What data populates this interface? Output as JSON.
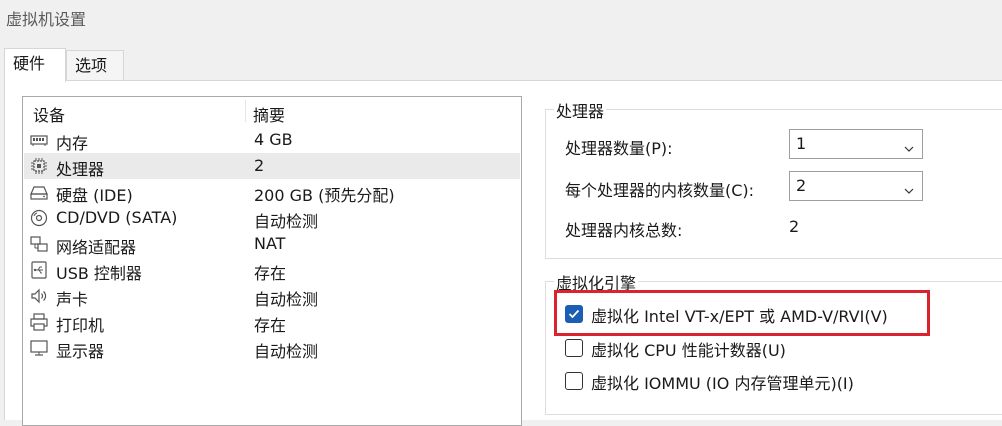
{
  "window": {
    "title": "虚拟机设置"
  },
  "tabs": [
    {
      "label": "硬件",
      "active": true
    },
    {
      "label": "选项",
      "active": false
    }
  ],
  "device_list": {
    "headers": {
      "device": "设备",
      "summary": "摘要"
    },
    "rows": [
      {
        "icon": "memory-icon",
        "name": "内存",
        "summary": "4 GB"
      },
      {
        "icon": "processor-icon",
        "name": "处理器",
        "summary": "2",
        "selected": true
      },
      {
        "icon": "harddisk-icon",
        "name": "硬盘 (IDE)",
        "summary": "200 GB (预先分配)"
      },
      {
        "icon": "cd-dvd-icon",
        "name": "CD/DVD (SATA)",
        "summary": "自动检测"
      },
      {
        "icon": "network-adapter-icon",
        "name": "网络适配器",
        "summary": "NAT"
      },
      {
        "icon": "usb-icon",
        "name": "USB 控制器",
        "summary": "存在"
      },
      {
        "icon": "sound-card-icon",
        "name": "声卡",
        "summary": "自动检测"
      },
      {
        "icon": "printer-icon",
        "name": "打印机",
        "summary": "存在"
      },
      {
        "icon": "display-icon",
        "name": "显示器",
        "summary": "自动检测"
      }
    ]
  },
  "processors": {
    "group_title": "处理器",
    "count_label": "处理器数量(P):",
    "count_value": "1",
    "cores_label": "每个处理器的内核数量(C):",
    "cores_value": "2",
    "total_label": "处理器内核总数:",
    "total_value": "2"
  },
  "virtualization": {
    "group_title": "虚拟化引擎",
    "options": [
      {
        "label": "虚拟化 Intel VT-x/EPT 或 AMD-V/RVI(V)",
        "checked": true
      },
      {
        "label": "虚拟化 CPU 性能计数器(U)",
        "checked": false
      },
      {
        "label": "虚拟化 IOMMU (IO 内存管理单元)(I)",
        "checked": false
      }
    ]
  },
  "colors": {
    "accent": "#1a5fb4",
    "highlight_border": "#d9232e",
    "selected_row": "#eaeaea"
  }
}
